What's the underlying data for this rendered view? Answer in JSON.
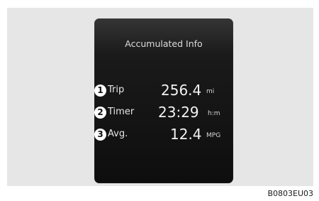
{
  "panel": {
    "title": "Accumulated Info",
    "items": [
      {
        "number": "1",
        "label": "Trip",
        "value": "256.4",
        "unit": "mi"
      },
      {
        "number": "2",
        "label": "Timer",
        "value": "23:29",
        "unit": "h:m"
      },
      {
        "number": "3",
        "label": "Avg.",
        "value": "12.4",
        "unit": "MPG"
      }
    ]
  },
  "figure_code": "B0803EU03",
  "colors": {
    "panel_background": "#0e0e0e",
    "frame_background": "#e6e6e6",
    "text": "#f2f2f2"
  }
}
